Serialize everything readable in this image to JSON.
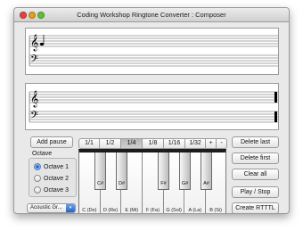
{
  "window": {
    "title": "Coding Workshop Ringtone Converter : Composer"
  },
  "toolbar": {
    "add_pause": "Add pause",
    "durations": [
      "1/1",
      "1/2",
      "1/4",
      "1/8",
      "1/16",
      "1/32",
      "+",
      "-"
    ],
    "selected_duration": "1/4"
  },
  "octave": {
    "label": "Octave",
    "options": [
      "Octave 1",
      "Octave 2",
      "Octave 3"
    ],
    "selected": "Octave 1"
  },
  "instrument": {
    "value": "Acoustic Gr..."
  },
  "keyboard": {
    "white_keys": [
      "C (Do)",
      "D (Re)",
      "E (Mi)",
      "F (Fa)",
      "G (Sol)",
      "A (La)",
      "B (Si)"
    ],
    "black_keys": [
      "C#",
      "D#",
      "F#",
      "G#",
      "A#"
    ]
  },
  "actions": {
    "delete_last": "Delete last",
    "delete_first": "Delete first",
    "clear_all": "Clear all",
    "play_stop": "Play / Stop",
    "create_rtttl": "Create RTTTL"
  },
  "clefs": {
    "treble": "𝄞",
    "bass": "𝄢"
  },
  "colors": {
    "accent": "#2b62c4",
    "close": "#e0443e",
    "minimize": "#dea123",
    "zoom": "#5fbf3a"
  }
}
